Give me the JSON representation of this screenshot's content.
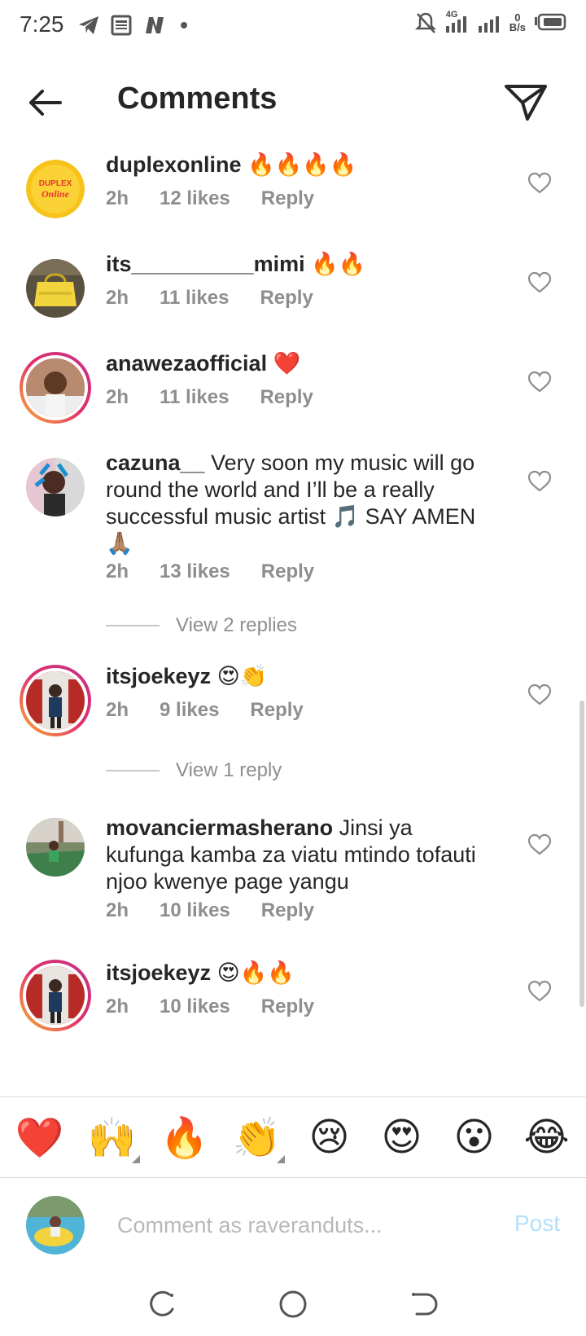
{
  "status_bar": {
    "time": "7:25",
    "network_type": "4G",
    "net_speed_value": "0",
    "net_speed_unit": "B/s",
    "icons": [
      "telegram-icon",
      "news-icon",
      "n-app-icon",
      "notification-dot",
      "mute-bell-icon",
      "signal-icon",
      "signal-icon-2",
      "battery-icon"
    ]
  },
  "header": {
    "title": "Comments",
    "back_icon": "arrow-left-icon",
    "send_icon": "paper-plane-icon"
  },
  "comments": [
    {
      "username": "duplexonline",
      "text": "🔥🔥🔥🔥",
      "time": "2h",
      "likes": "12 likes",
      "reply": "Reply",
      "story_ring": false,
      "avatar_text": "DUPLEX Online"
    },
    {
      "username": "its__________mimi",
      "text": "🔥🔥",
      "time": "2h",
      "likes": "11 likes",
      "reply": "Reply",
      "story_ring": false
    },
    {
      "username": "anawezaofficial",
      "text": "❤️",
      "time": "2h",
      "likes": "11 likes",
      "reply": "Reply",
      "story_ring": true
    },
    {
      "username": "cazuna__",
      "text": "Very soon my music will go round the world and I’ll be a really successful music artist 🎵 SAY AMEN 🙏🏽",
      "time": "2h",
      "likes": "13 likes",
      "reply": "Reply",
      "story_ring": false,
      "view_replies": "View 2 replies"
    },
    {
      "username": "itsjoekeyz",
      "text": "😍👏",
      "time": "2h",
      "likes": "9 likes",
      "reply": "Reply",
      "story_ring": true,
      "view_replies": "View 1 reply"
    },
    {
      "username": "movanciermasherano",
      "text": "Jinsi ya kufunga kamba za viatu mtindo tofauti njoo kwenye page yangu",
      "time": "2h",
      "likes": "10 likes",
      "reply": "Reply",
      "story_ring": false
    },
    {
      "username": "itsjoekeyz",
      "text": "😍🔥🔥",
      "time": "2h",
      "likes": "10 likes",
      "reply": "Reply",
      "story_ring": true
    }
  ],
  "quick_emojis": [
    "❤️",
    "🙌",
    "🔥",
    "👏",
    "😢",
    "😍",
    "😮",
    "😂"
  ],
  "composer": {
    "placeholder": "Comment as raveranduts...",
    "post_label": "Post",
    "post_color": "#b2dffc"
  },
  "colors": {
    "text_primary": "#262626",
    "text_secondary": "#8e8e8e",
    "ring_gradient": [
      "#f9b233",
      "#e1306c",
      "#c13584"
    ]
  }
}
